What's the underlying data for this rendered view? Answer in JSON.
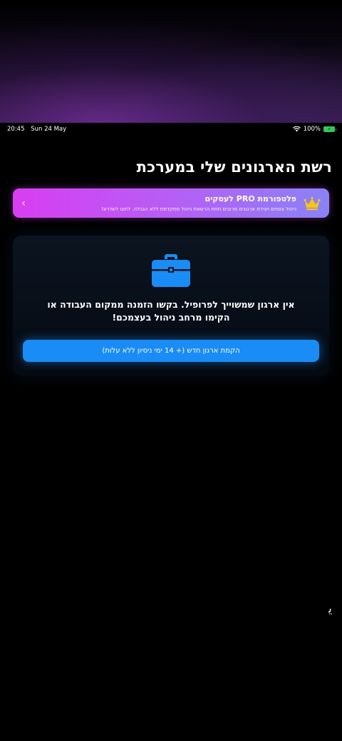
{
  "status_bar": {
    "time": "20:45",
    "date": "Sun 24 May",
    "battery_percent": "100%",
    "icons": [
      "wifi-icon",
      "battery-charging-icon"
    ]
  },
  "page": {
    "title": "רשת הארגונים שלי במערכת"
  },
  "pro_banner": {
    "title": "פלטפורמת PRO לעסקים",
    "subtitle": "ניהול צוותים ויצירת ארגונים מרובים תחת הרשאת ניהול מתקדמת ללא הגבלה. לחצו לשדרוג!",
    "icon": "crown-icon",
    "chevron": "‹",
    "colors": [
      "#d93df2",
      "#8a82f7"
    ]
  },
  "empty_state": {
    "icon": "briefcase-icon",
    "message": "אין ארגון שמשוייך לפרופיל. בקשו הזמנה ממקום העבודה או הקימו מרחב ניהול בעצמכם!",
    "create_button_label": "הקמת ארגון חדש (+ 14 ימי ניסיון ללא עלות)",
    "accent": "#1a8cf5"
  }
}
